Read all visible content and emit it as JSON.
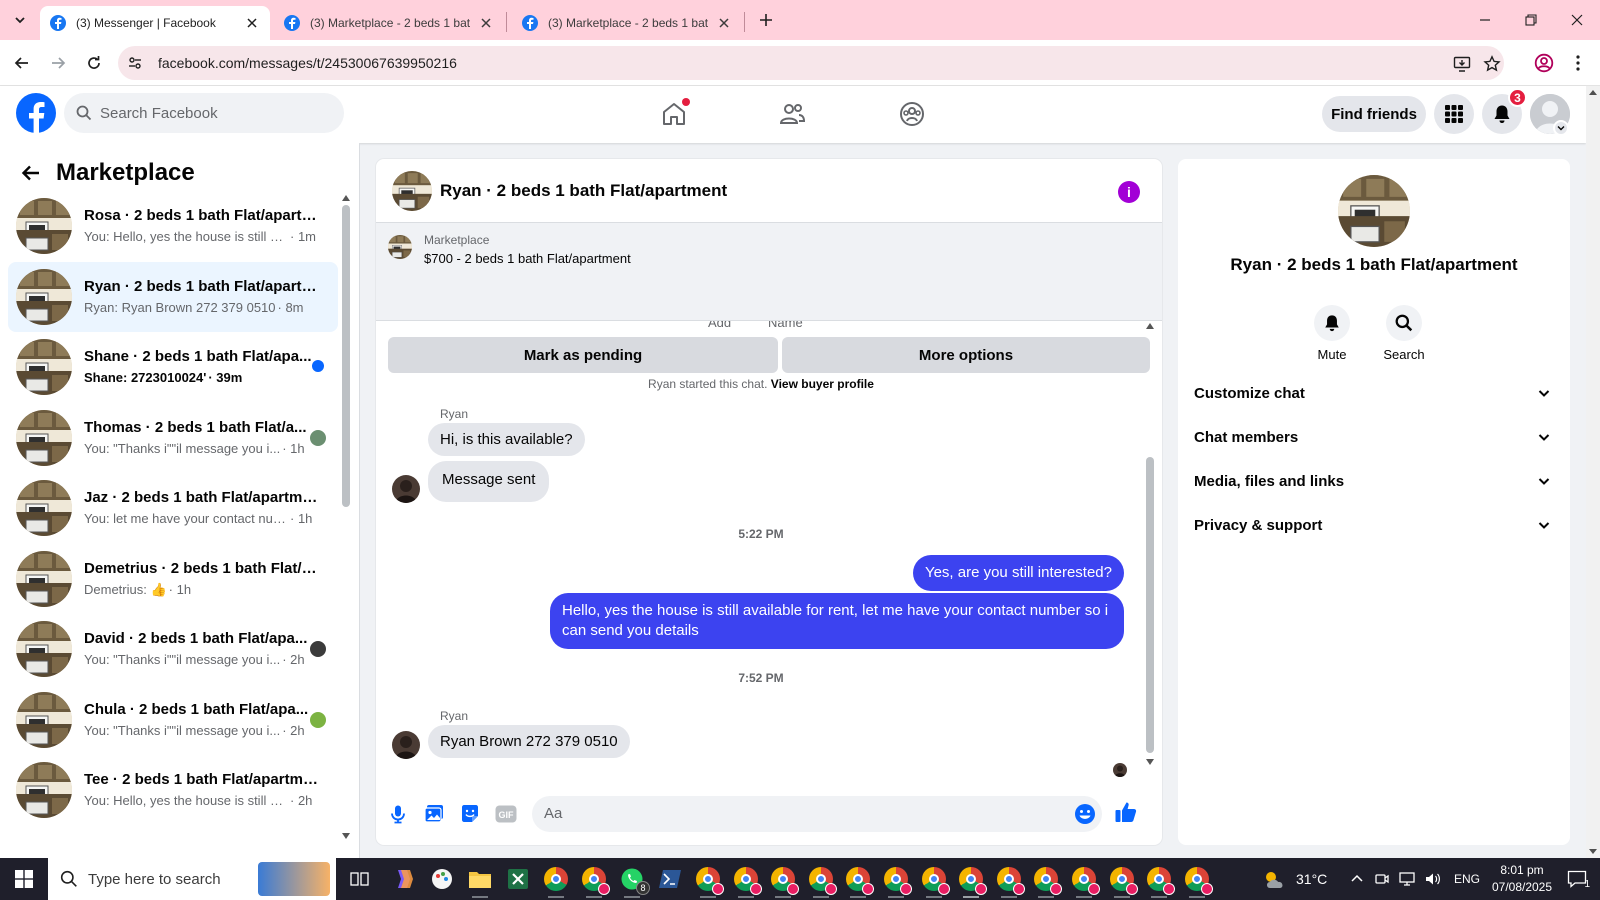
{
  "browser": {
    "tabs": [
      {
        "title": "(3) Messenger | Facebook",
        "active": true
      },
      {
        "title": "(3) Marketplace - 2 beds 1 bath",
        "active": false
      },
      {
        "title": "(3) Marketplace - 2 beds 1 bath",
        "active": false
      }
    ],
    "url": "facebook.com/messages/t/24530067639950216"
  },
  "header": {
    "search_placeholder": "Search Facebook",
    "find_friends": "Find friends",
    "notification_count": "3"
  },
  "sidebar": {
    "title": "Marketplace",
    "conversations": [
      {
        "name": "Rosa · 2 beds 1 bath Flat/apartm...",
        "preview": "You: Hello, yes the house is still av...",
        "time": "· 1m",
        "status": "none",
        "active": false,
        "unread": false
      },
      {
        "name": "Ryan · 2 beds 1 bath Flat/apartm...",
        "preview": "Ryan: Ryan Brown 272 379 0510",
        "time": "· 8m",
        "status": "none",
        "active": true,
        "unread": false
      },
      {
        "name": "Shane · 2 beds 1 bath Flat/apa...",
        "preview": "Shane: 2723010024'",
        "time": "· 39m",
        "status": "unread",
        "active": false,
        "unread": true
      },
      {
        "name": "Thomas · 2 beds 1 bath Flat/a...",
        "preview": "You: \"Thanks i\"\"il message you i...",
        "time": "· 1h",
        "status": "seen",
        "active": false,
        "unread": false
      },
      {
        "name": "Jaz · 2 beds 1 bath Flat/apartment",
        "preview": "You: let me have your contact num...",
        "time": "· 1h",
        "status": "none",
        "active": false,
        "unread": false
      },
      {
        "name": "Demetrius · 2 beds 1 bath Flat/a...",
        "preview": "Demetrius: 👍",
        "time": "· 1h",
        "status": "none",
        "active": false,
        "unread": false
      },
      {
        "name": "David · 2 beds 1 bath Flat/apa...",
        "preview": "You: \"Thanks i\"\"il message you i...",
        "time": "· 2h",
        "status": "seen",
        "active": false,
        "unread": false
      },
      {
        "name": "Chula · 2 beds 1 bath Flat/apa...",
        "preview": "You: \"Thanks i\"\"il message you i...",
        "time": "· 2h",
        "status": "seen",
        "active": false,
        "unread": false
      },
      {
        "name": "Tee · 2 beds 1 bath Flat/apartment",
        "preview": "You: Hello, yes the house is still avai...",
        "time": "· 2h",
        "status": "none",
        "active": false,
        "unread": false
      }
    ]
  },
  "chat": {
    "title": "Ryan · 2 beds 1 bath Flat/apartment",
    "listing_label": "Marketplace",
    "listing_info": "$700 - 2 beds 1 bath Flat/apartment",
    "mark_pending": "Mark as pending",
    "more_options": "More options",
    "cutoff_left": "Add",
    "cutoff_right": "Name",
    "started_text": "Ryan started this chat.",
    "view_buyer": "View buyer profile",
    "sender_name": "Ryan",
    "incoming_1": "Hi, is this available?",
    "incoming_2": "Message sent",
    "time_1": "5:22 PM",
    "outgoing_1": "Yes, are you still interested?",
    "outgoing_2": "Hello, yes the house is still available for rent, let me have your contact number so i can send you details",
    "time_2": "7:52 PM",
    "incoming_3": "Ryan Brown 272 379 0510",
    "composer_placeholder": "Aa"
  },
  "details": {
    "name": "Ryan · 2 beds 1 bath Flat/apartment",
    "mute": "Mute",
    "search": "Search",
    "sections": [
      "Customize chat",
      "Chat members",
      "Media, files and links",
      "Privacy & support"
    ]
  },
  "taskbar": {
    "search_placeholder": "Type here to search",
    "whatsapp_badge": "8",
    "weather": "31°C",
    "lang": "ENG",
    "time": "8:01 pm",
    "date": "07/08/2025",
    "notif_count": "1"
  },
  "colors": {
    "fb_blue": "#0866ff",
    "outgoing_bubble": "#3c43f0",
    "info_purple": "#a200d6",
    "tab_strip": "#ffd1dc"
  }
}
